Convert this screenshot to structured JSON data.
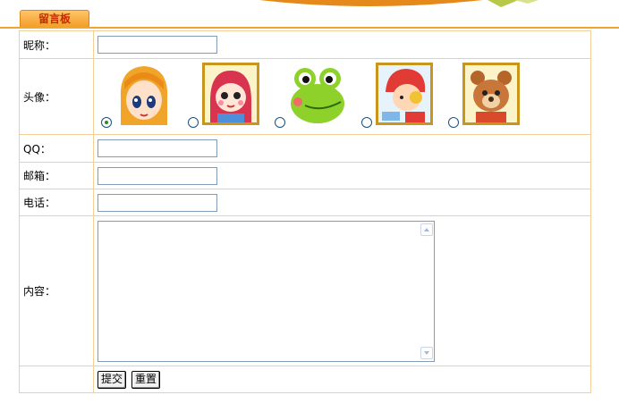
{
  "tab": {
    "title": "留言板"
  },
  "form": {
    "nickname_label": "昵称：",
    "avatar_label": "头像：",
    "qq_label": "QQ：",
    "email_label": "邮箱：",
    "phone_label": "电话：",
    "content_label": "内容：",
    "avatars": [
      {
        "name": "orange-haired-girl-avatar",
        "selected": true
      },
      {
        "name": "pink-hooded-doll-avatar",
        "selected": false
      },
      {
        "name": "green-frog-avatar",
        "selected": false
      },
      {
        "name": "red-helmet-kid-avatar",
        "selected": false
      },
      {
        "name": "brown-bear-avatar",
        "selected": false
      }
    ],
    "nickname_value": "",
    "qq_value": "",
    "email_value": "",
    "phone_value": "",
    "content_value": ""
  },
  "buttons": {
    "submit": "提交",
    "reset": "重置"
  },
  "colors": {
    "accent": "#f0a52e",
    "border": "#f2cf99",
    "tab_text": "#c62a00"
  }
}
